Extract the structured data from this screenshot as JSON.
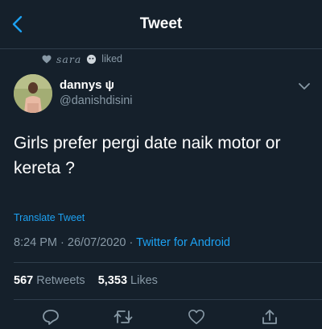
{
  "header": {
    "title": "Tweet",
    "back_icon": "back-arrow-icon"
  },
  "social_context": {
    "name": "sara",
    "action": "liked"
  },
  "tweet": {
    "display_name": "dannys ψ",
    "handle": "@danishdisini",
    "text_line1": "Girls prefer pergi date naik motor or",
    "text_line2": "kereta ?",
    "translate": "Translate Tweet",
    "time": "8:24 PM",
    "date": "26/07/2020",
    "separator": "·",
    "source": "Twitter for Android"
  },
  "stats": {
    "retweets_count": "567",
    "retweets_label": "Retweets",
    "likes_count": "5,353",
    "likes_label": "Likes"
  },
  "actions": [
    "reply-icon",
    "retweet-icon",
    "like-icon",
    "share-icon"
  ],
  "colors": {
    "background": "#15202b",
    "accent": "#1da1f2",
    "muted": "#8899a6",
    "divider": "#2f3d4b"
  }
}
